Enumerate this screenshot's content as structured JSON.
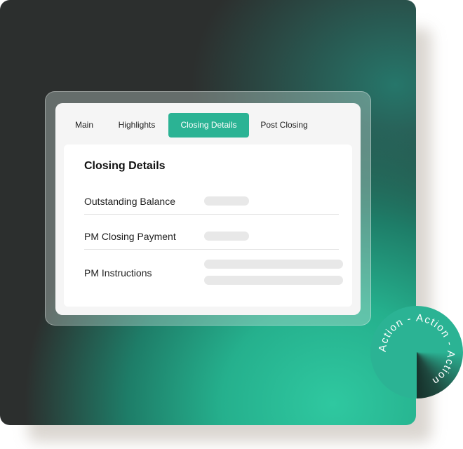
{
  "tabs": [
    {
      "label": "Main",
      "active": false
    },
    {
      "label": "Highlights",
      "active": false
    },
    {
      "label": "Closing Details",
      "active": true
    },
    {
      "label": "Post Closing",
      "active": false
    }
  ],
  "section": {
    "title": "Closing Details",
    "rows": [
      {
        "label": "Outstanding Balance"
      },
      {
        "label": "PM Closing Payment"
      },
      {
        "label": "PM Instructions"
      }
    ]
  },
  "badge": {
    "text": "Action - Action - Action"
  },
  "colors": {
    "accent": "#2bb394",
    "background_dark": "#2c2f2e",
    "placeholder": "#e8e8e8"
  }
}
